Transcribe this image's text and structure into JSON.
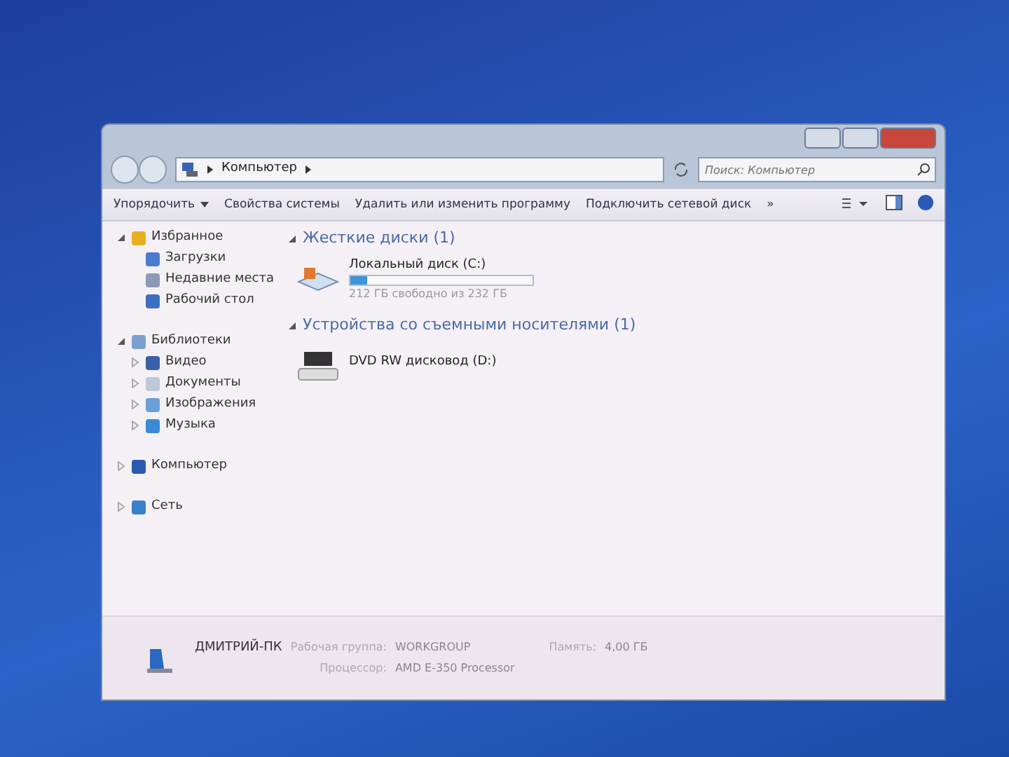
{
  "address": {
    "crumbs": [
      "Компьютер"
    ]
  },
  "search": {
    "placeholder": "Поиск: Компьютер"
  },
  "toolbar": {
    "items": [
      {
        "label": "Упорядочить",
        "kind": "menu"
      },
      {
        "label": "Свойства системы",
        "kind": "plain"
      },
      {
        "label": "Удалить или изменить программу",
        "kind": "plain"
      },
      {
        "label": "Подключить сетевой диск",
        "kind": "plain"
      },
      {
        "label": "»",
        "kind": "plain"
      }
    ]
  },
  "sidebar": {
    "items": [
      {
        "label": "Избранное",
        "expanded": true,
        "children": [
          {
            "label": "Загрузки"
          },
          {
            "label": "Недавние места"
          },
          {
            "label": "Рабочий стол"
          }
        ]
      },
      {
        "label": "Библиотеки",
        "expanded": true,
        "children": [
          {
            "label": "Видео",
            "expanded": false
          },
          {
            "label": "Документы",
            "expanded": false
          },
          {
            "label": "Изображения",
            "expanded": false
          },
          {
            "label": "Музыка",
            "expanded": false
          }
        ]
      },
      {
        "label": "Компьютер",
        "expanded": false
      },
      {
        "label": "Сеть",
        "expanded": false
      }
    ]
  },
  "groups": [
    {
      "title": "Жесткие диски (1)",
      "expanded": true,
      "items": [
        {
          "kind": "disk",
          "name": "Локальный диск (C:)",
          "level": 0.09,
          "info": "212 ГБ свободно из 232 ГБ"
        }
      ]
    },
    {
      "title": "Устройства со съемными носителями (1)",
      "expanded": true,
      "items": [
        {
          "kind": "dvd",
          "name": "DVD RW дисковод (D:)"
        }
      ]
    }
  ],
  "details": {
    "name": "ДМИТРИЙ-ПК",
    "fields": [
      {
        "label": "Рабочая группа:",
        "value": "WORKGROUP"
      },
      {
        "label": "Память:",
        "value": "4,00 ГБ"
      },
      {
        "label": "Процессор:",
        "value": "AMD E-350 Processor"
      }
    ]
  }
}
